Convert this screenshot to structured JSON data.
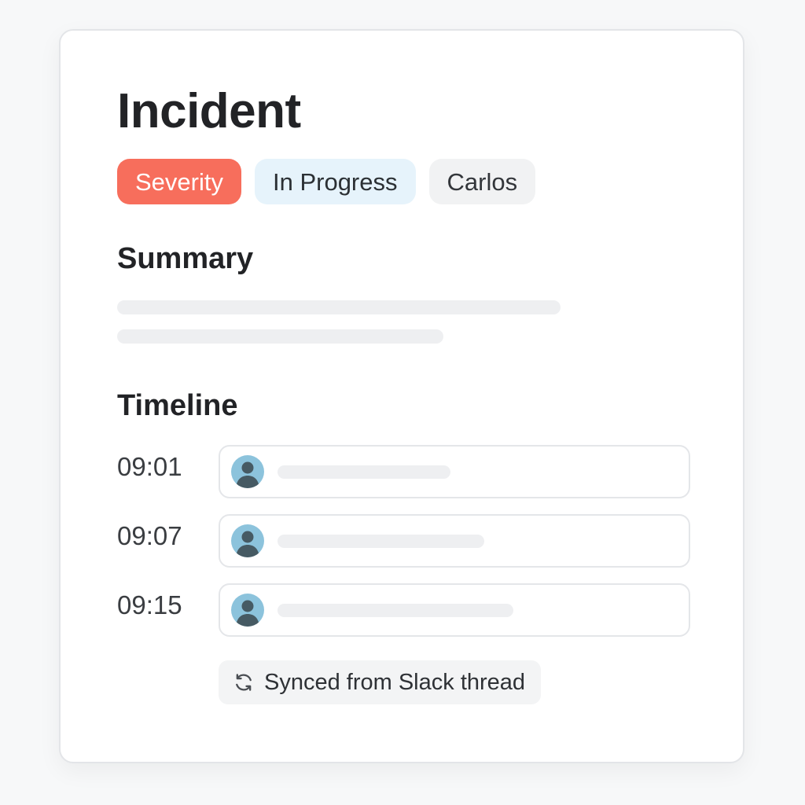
{
  "card": {
    "title": "Incident",
    "tags": {
      "severity": "Severity",
      "status": "In Progress",
      "owner": "Carlos"
    },
    "summary": {
      "heading": "Summary"
    },
    "timeline": {
      "heading": "Timeline",
      "entries": [
        {
          "time": "09:01"
        },
        {
          "time": "09:07"
        },
        {
          "time": "09:15"
        }
      ]
    },
    "sync": {
      "label": "Synced from Slack thread",
      "icon": "refresh-icon"
    }
  },
  "colors": {
    "severity_bg": "#f76e5c",
    "status_bg": "#e6f3fb",
    "owner_bg": "#f1f2f3",
    "avatar": "#8cc3dc",
    "avatar_figure": "#465a63"
  }
}
